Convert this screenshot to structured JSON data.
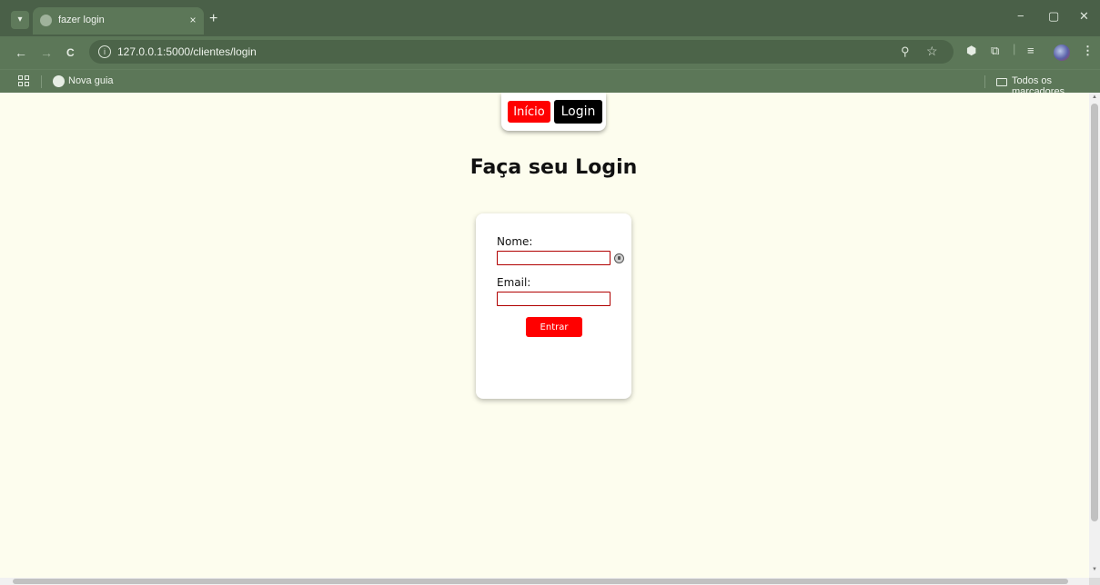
{
  "browser": {
    "tab_title": "fazer login",
    "tab_close": "×",
    "new_tab": "+",
    "url": "127.0.0.1:5000/clientes/login",
    "back": "←",
    "forward": "→",
    "reload": "C",
    "window_minimize": "−",
    "window_restore": "▢",
    "window_close": "✕",
    "bookmarks": {
      "new_tab_label": "Nova guia",
      "all_bookmarks_label": "Todos os marcadores"
    },
    "icons": [
      "tab-search-icon",
      "favicon-icon",
      "site-info-icon",
      "zoom-icon",
      "star-icon",
      "extension-icon",
      "puzzle-icon",
      "reading-list-icon",
      "profile-icon",
      "menu-icon",
      "apps-icon",
      "globe-icon",
      "folder-icon"
    ],
    "colors": {
      "chrome": "#5c7758",
      "tabstrip": "#4a6048"
    }
  },
  "page": {
    "background": "#fdfdee",
    "nav": {
      "inicio_label": "Início",
      "login_label": "Login"
    },
    "title": "Faça seu Login",
    "form": {
      "nome_label": "Nome:",
      "nome_value": "",
      "email_label": "Email:",
      "email_value": "",
      "submit_label": "Entrar"
    },
    "colors": {
      "accent": "#ff0000",
      "dark": "#000000"
    }
  }
}
